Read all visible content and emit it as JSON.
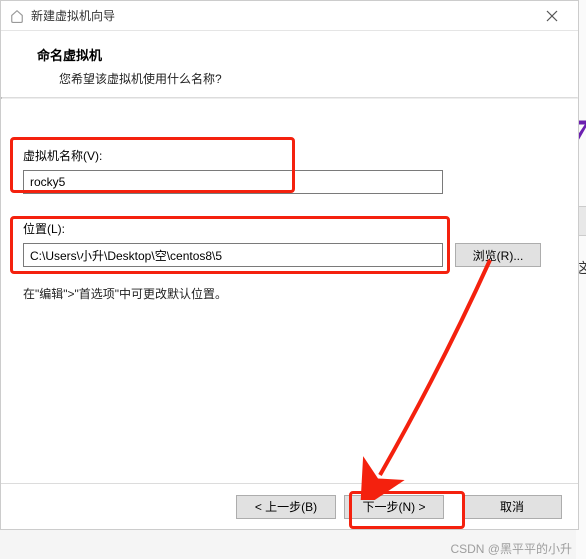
{
  "window": {
    "title": "新建虚拟机向导"
  },
  "header": {
    "title": "命名虚拟机",
    "subtitle": "您希望该虚拟机使用什么名称?"
  },
  "fields": {
    "name_label": "虚拟机名称(V):",
    "name_value": "rocky5",
    "location_label": "位置(L):",
    "location_value": "C:\\Users\\小升\\Desktop\\空\\centos8\\5",
    "browse_label": "浏览(R)...",
    "hint": "在\"编辑\">\"首选项\"中可更改默认位置。"
  },
  "footer": {
    "back": "< 上一步(B)",
    "next": "下一步(N) >",
    "cancel": "取消"
  },
  "background": {
    "char": "这"
  },
  "watermark": "CSDN @黑平平的小升",
  "annotation_color": "#f4210e"
}
